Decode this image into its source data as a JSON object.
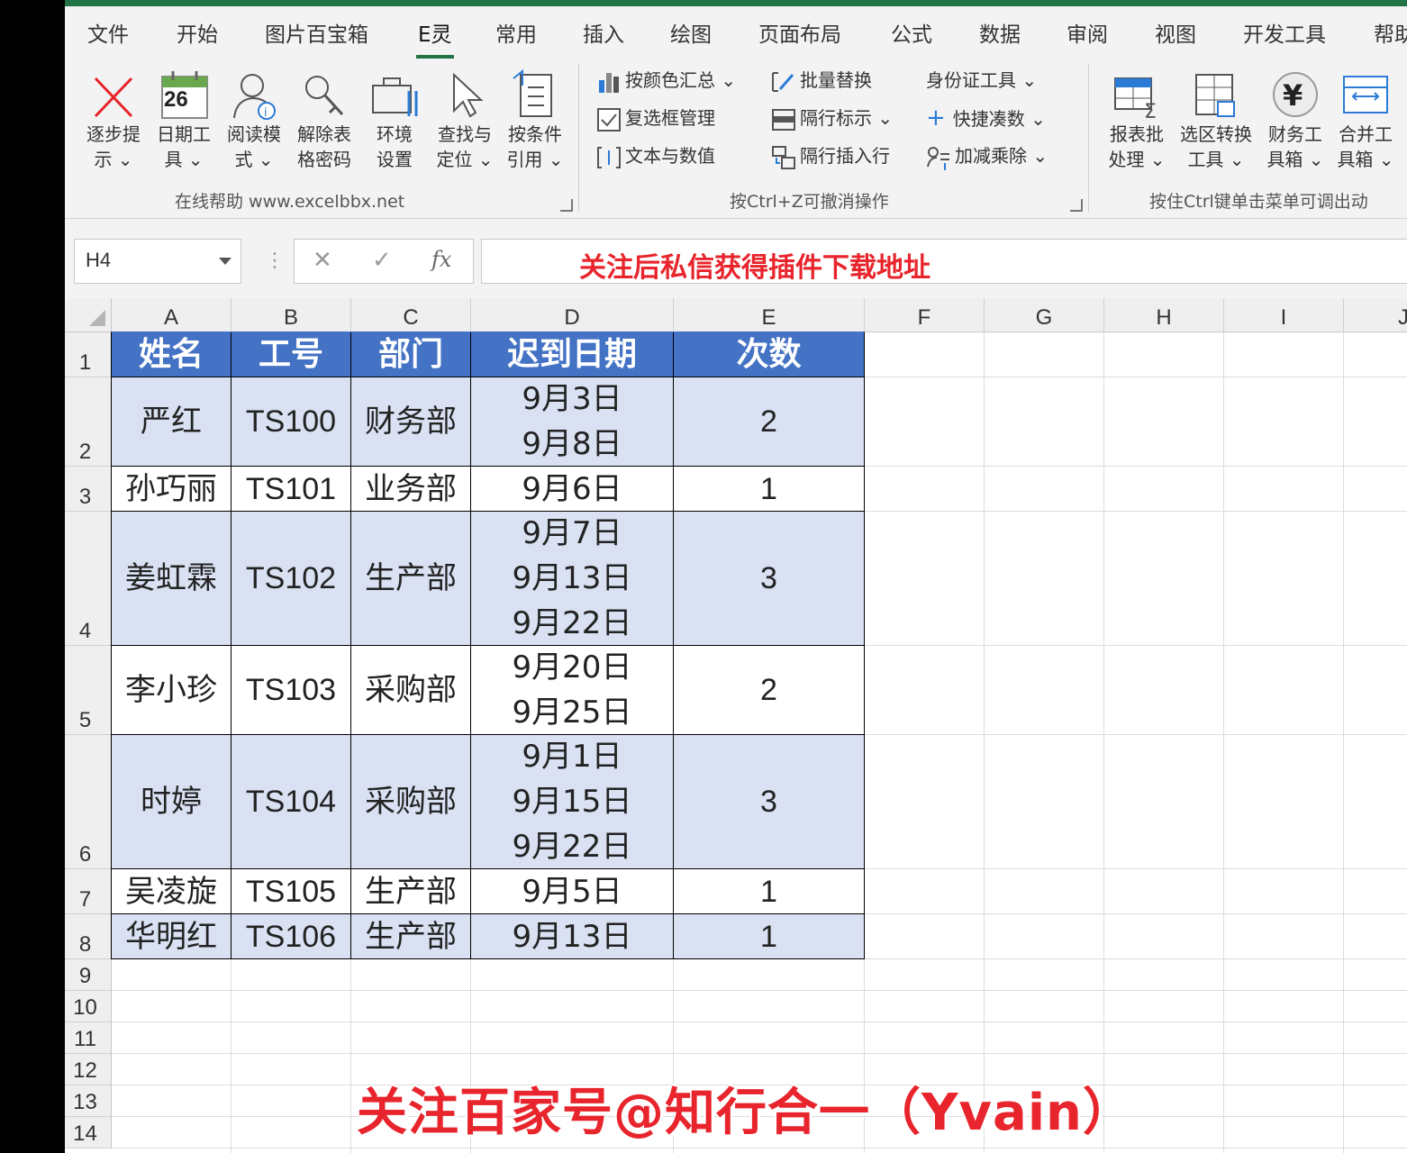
{
  "ribbon": {
    "tabs": [
      "文件",
      "开始",
      "图片百宝箱",
      "E灵",
      "常用",
      "插入",
      "绘图",
      "页面布局",
      "公式",
      "数据",
      "审阅",
      "视图",
      "开发工具",
      "帮助"
    ],
    "active_tab": "E灵",
    "group1": {
      "buttons": [
        "逐步提\n示 ⌄",
        "日期工\n具 ⌄",
        "阅读模\n式 ⌄",
        "解除表\n格密码",
        "环境\n设置",
        "查找与\n定位 ⌄",
        "按条件\n引用 ⌄"
      ],
      "calendar_day": "26",
      "label": "在线帮助   www.excelbbx.net"
    },
    "group2": {
      "items": [
        "按颜色汇总  ⌄",
        "复选框管理",
        "文本与数值",
        "批量替换",
        "隔行标示  ⌄",
        "隔行插入行",
        "身份证工具 ⌄",
        "快捷凑数  ⌄",
        "加减乘除 ⌄"
      ],
      "label": "按Ctrl+Z可撤消操作"
    },
    "group3": {
      "buttons": [
        "报表批\n处理 ⌄",
        "选区转换\n工具 ⌄",
        "财务工\n具箱 ⌄",
        "合并工\n具箱 ⌄"
      ],
      "label": "按住Ctrl键单击菜单可调出动"
    }
  },
  "formula_bar": {
    "name_box": "H4",
    "cancel": "✕",
    "enter": "✓",
    "fx": "fx",
    "content": "关注后私信获得插件下载地址"
  },
  "sheet": {
    "columns": [
      "A",
      "B",
      "C",
      "D",
      "E",
      "F",
      "G",
      "H",
      "I",
      "J"
    ],
    "rows": [
      "1",
      "2",
      "3",
      "4",
      "5",
      "6",
      "7",
      "8",
      "9",
      "10",
      "11",
      "12",
      "13",
      "14"
    ],
    "header": [
      "姓名",
      "工号",
      "部门",
      "迟到日期",
      "次数"
    ],
    "data": [
      [
        "严红",
        "TS100",
        "财务部",
        "9月3日\n9月8日",
        "2"
      ],
      [
        "孙巧丽",
        "TS101",
        "业务部",
        "9月6日",
        "1"
      ],
      [
        "姜虹霖",
        "TS102",
        "生产部",
        "9月7日\n9月13日\n9月22日",
        "3"
      ],
      [
        "李小珍",
        "TS103",
        "采购部",
        "9月20日\n9月25日",
        "2"
      ],
      [
        "时婷",
        "TS104",
        "采购部",
        "9月1日\n9月15日\n9月22日",
        "3"
      ],
      [
        "吴凌旋",
        "TS105",
        "生产部",
        "9月5日",
        "1"
      ],
      [
        "华明红",
        "TS106",
        "生产部",
        "9月13日",
        "1"
      ]
    ]
  },
  "watermark": "关注百家号@知行合一（Yvain）",
  "colors": {
    "accent": "#217346",
    "table_header": "#4472c4",
    "band": "#d9e1f2",
    "formula_text": "#e8242c"
  }
}
